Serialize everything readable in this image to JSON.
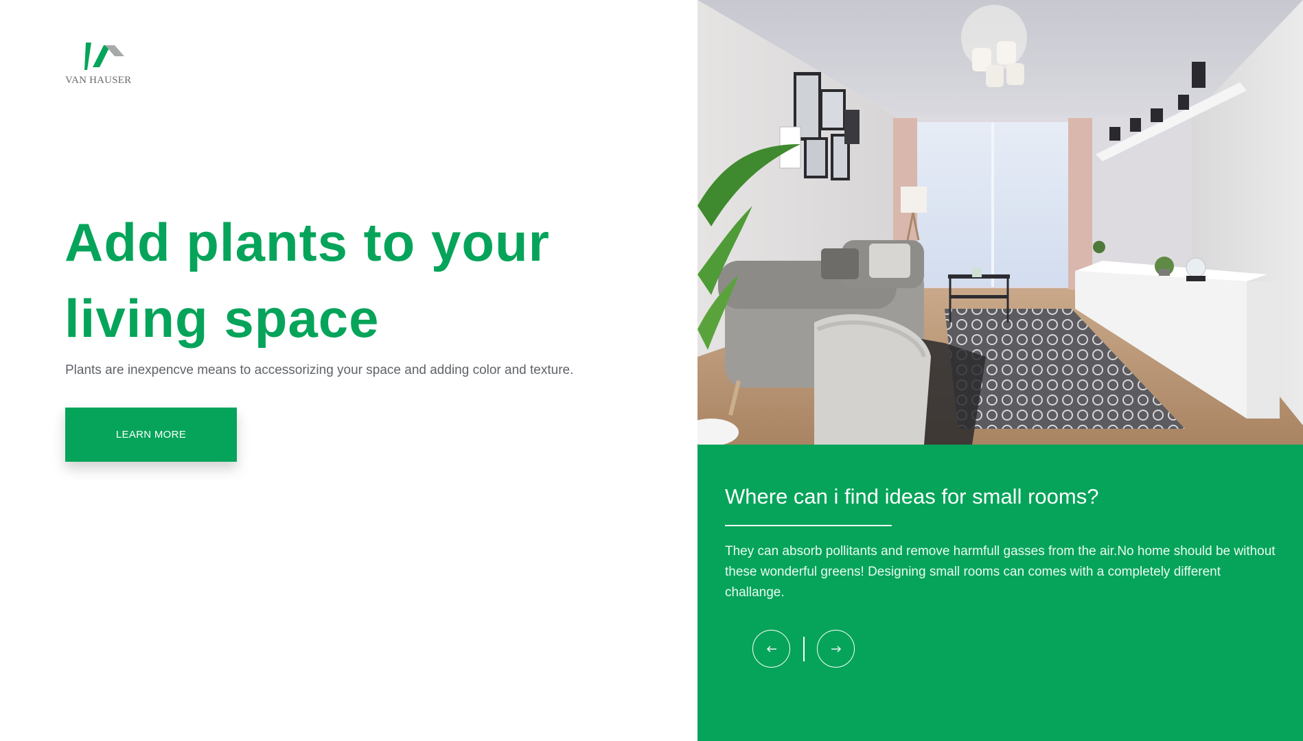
{
  "brand": {
    "name": "VAN HAUSER",
    "logo_colors": [
      "#06a45a",
      "#a6aaa8"
    ]
  },
  "hero": {
    "headline": "Add plants to your living space",
    "subtext": "Plants are inexpencve means to accessorizing your space and adding color and texture.",
    "cta_label": "LEARN MORE"
  },
  "photo": {
    "subject": "living-room-image"
  },
  "info": {
    "title": "Where can i find ideas for small rooms?",
    "body": "They can absorb pollitants and remove harmfull gasses from the air.No home should be without these wonderful greens! Designing small rooms can comes with a completely different challange.",
    "prev_icon": "arrow-left-icon",
    "next_icon": "arrow-right-icon"
  },
  "colors": {
    "accent": "#06a45a",
    "text_gray": "#5f6368",
    "white": "#ffffff"
  }
}
